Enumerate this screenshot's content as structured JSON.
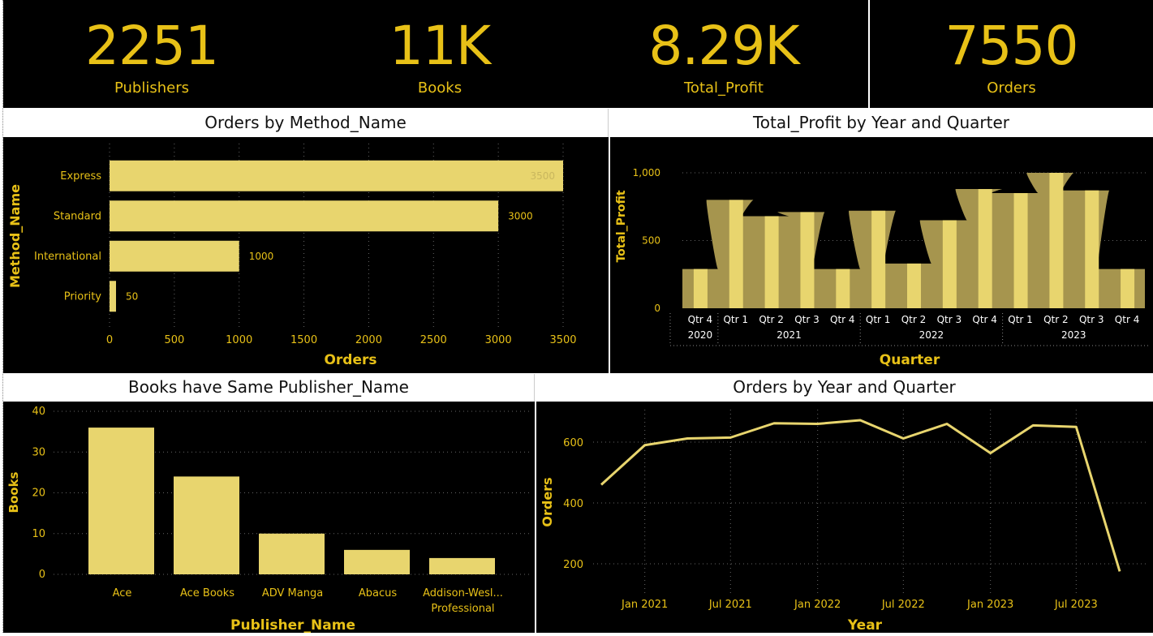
{
  "kpis": [
    {
      "value": "2251",
      "label": "Publishers"
    },
    {
      "value": "11K",
      "label": "Books"
    },
    {
      "value": "8.29K",
      "label": "Total_Profit"
    },
    {
      "value": "7550",
      "label": "Orders"
    }
  ],
  "colors": {
    "bar": "#E8D56E",
    "bar_alt": "#A6954E",
    "text": "#E8C117",
    "bg": "#000000"
  },
  "chart_data": [
    {
      "type": "bar",
      "orientation": "horizontal",
      "title": "Orders by Method_Name",
      "xlabel": "Orders",
      "ylabel": "Method_Name",
      "categories": [
        "Express",
        "Standard",
        "International",
        "Priority"
      ],
      "values": [
        3500,
        3000,
        1000,
        50
      ],
      "data_labels": [
        "3500",
        "3000",
        "1000",
        "50"
      ],
      "xlim": [
        0,
        3500
      ],
      "xticks": [
        0,
        500,
        1000,
        1500,
        2000,
        2500,
        3000,
        3500
      ]
    },
    {
      "type": "area",
      "title": "Total_Profit by Year and Quarter",
      "xlabel": "Quarter",
      "ylabel": "Total_Profit",
      "quarters": [
        "Qtr 4",
        "Qtr 1",
        "Qtr 2",
        "Qtr 3",
        "Qtr 4",
        "Qtr 1",
        "Qtr 2",
        "Qtr 3",
        "Qtr 4",
        "Qtr 1",
        "Qtr 2",
        "Qtr 3",
        "Qtr 4"
      ],
      "years": [
        {
          "label": "2020",
          "span": 1
        },
        {
          "label": "2021",
          "span": 4
        },
        {
          "label": "2022",
          "span": 4
        },
        {
          "label": "2023",
          "span": 4
        }
      ],
      "values": [
        290,
        800,
        680,
        710,
        290,
        720,
        330,
        650,
        880,
        850,
        1000,
        870,
        290
      ],
      "ylim": [
        0,
        1000
      ],
      "yticks": [
        "0",
        "500",
        "1,000"
      ]
    },
    {
      "type": "bar",
      "title": "Books have Same Publisher_Name",
      "xlabel": "Publisher_Name",
      "ylabel": "Books",
      "categories": [
        "Ace",
        "Ace Books",
        "ADV Manga",
        "Abacus",
        "Addison-Wesl... Professional"
      ],
      "values": [
        36,
        24,
        10,
        6,
        4
      ],
      "ylim": [
        0,
        40
      ],
      "yticks": [
        0,
        10,
        20,
        30,
        40
      ]
    },
    {
      "type": "line",
      "title": "Orders by Year and Quarter",
      "xlabel": "Year",
      "ylabel": "Orders",
      "x": [
        "2020-10-01",
        "2021-01-01",
        "2021-04-01",
        "2021-07-01",
        "2021-10-01",
        "2022-01-01",
        "2022-04-01",
        "2022-07-01",
        "2022-10-01",
        "2023-01-01",
        "2023-04-01",
        "2023-07-01",
        "2023-10-01"
      ],
      "values": [
        460,
        590,
        612,
        615,
        662,
        660,
        672,
        612,
        660,
        564,
        655,
        650,
        175
      ],
      "xtick_labels": [
        "Jan 2021",
        "Jul 2021",
        "Jan 2022",
        "Jul 2022",
        "Jan 2023",
        "Jul 2023"
      ],
      "yticks": [
        200,
        400,
        600
      ]
    }
  ]
}
